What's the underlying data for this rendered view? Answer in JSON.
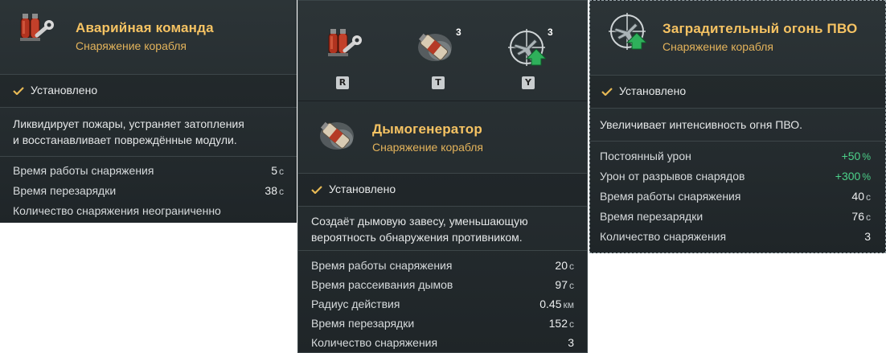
{
  "panels": {
    "damage_control": {
      "title": "Аварийная команда",
      "subtitle": "Снаряжение корабля",
      "status": "Установлено",
      "description": [
        "Ликвидирует пожары, устраняет затопления",
        "и восстанавливает повреждённые модули."
      ],
      "stats": [
        {
          "label": "Время работы снаряжения",
          "value": "5",
          "unit": "с"
        },
        {
          "label": "Время перезарядки",
          "value": "38",
          "unit": "с"
        },
        {
          "label": "Количество снаряжения неограниченно",
          "value": "",
          "unit": ""
        }
      ],
      "icon": "damage-control-icon"
    },
    "smoke_generator": {
      "slots": [
        {
          "icon": "damage-control-icon",
          "key": "R",
          "count": ""
        },
        {
          "icon": "smoke-generator-icon",
          "key": "T",
          "count": "3"
        },
        {
          "icon": "aa-barrage-icon",
          "key": "Y",
          "count": "3"
        }
      ],
      "title": "Дымогенератор",
      "subtitle": "Снаряжение корабля",
      "status": "Установлено",
      "description": [
        "Создаёт дымовую завесу, уменьшающую",
        "вероятность обнаружения противником."
      ],
      "stats": [
        {
          "label": "Время работы снаряжения",
          "value": "20",
          "unit": "с"
        },
        {
          "label": "Время рассеивания дымов",
          "value": "97",
          "unit": "с"
        },
        {
          "label": "Радиус действия",
          "value": "0.45",
          "unit": "км"
        },
        {
          "label": "Время перезарядки",
          "value": "152",
          "unit": "с"
        },
        {
          "label": "Количество снаряжения",
          "value": "3",
          "unit": ""
        }
      ],
      "icon": "smoke-generator-icon"
    },
    "aa_barrage": {
      "title": "Заградительный огонь ПВО",
      "subtitle": "Снаряжение корабля",
      "status": "Установлено",
      "description": [
        "Увеличивает интенсивность огня ПВО."
      ],
      "stats": [
        {
          "label": "Постоянный урон",
          "value": "+50",
          "unit": "%",
          "highlight": true
        },
        {
          "label": "Урон от разрывов снарядов",
          "value": "+300",
          "unit": "%",
          "highlight": true
        },
        {
          "label": "Время работы снаряжения",
          "value": "40",
          "unit": "с"
        },
        {
          "label": "Время перезарядки",
          "value": "76",
          "unit": "с"
        },
        {
          "label": "Количество снаряжения",
          "value": "3",
          "unit": ""
        }
      ],
      "icon": "aa-barrage-icon"
    }
  },
  "colors": {
    "title": "#f6c363",
    "subtitle": "#e3b35b",
    "positive": "#4cd28a",
    "panel_bg": "#272e31",
    "check": "#e7b955"
  }
}
